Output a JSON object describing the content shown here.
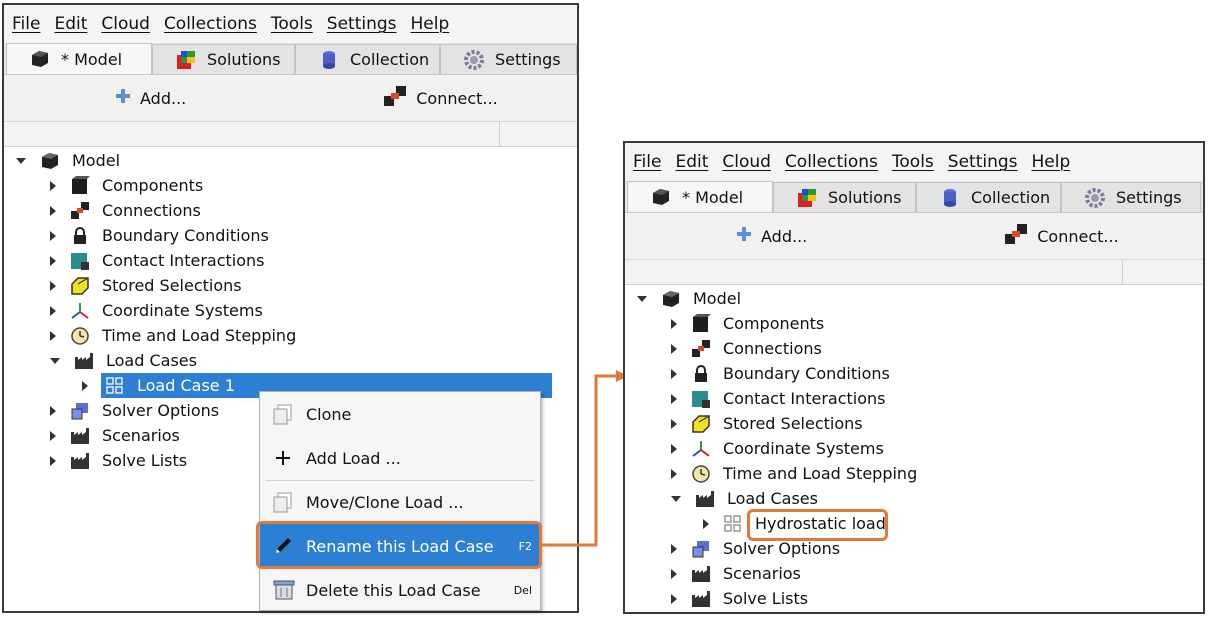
{
  "menu": [
    "File",
    "Edit",
    "Cloud",
    "Collections",
    "Tools",
    "Settings",
    "Help"
  ],
  "tabs": [
    {
      "label": "* Model",
      "icon": "model-cube-icon"
    },
    {
      "label": "Solutions",
      "icon": "solutions-icon"
    },
    {
      "label": "Collection",
      "icon": "collection-icon"
    },
    {
      "label": "Settings",
      "icon": "gear-icon"
    }
  ],
  "toolbar": {
    "add_label": "Add...",
    "connect_label": "Connect..."
  },
  "tree": {
    "root": "Model",
    "items": [
      {
        "label": "Components",
        "icon": "component-cube-icon"
      },
      {
        "label": "Connections",
        "icon": "connection-icon"
      },
      {
        "label": "Boundary Conditions",
        "icon": "lock-icon"
      },
      {
        "label": "Contact Interactions",
        "icon": "contact-icon"
      },
      {
        "label": "Stored Selections",
        "icon": "selection-icon"
      },
      {
        "label": "Coordinate Systems",
        "icon": "axes-icon"
      },
      {
        "label": "Time and Load Stepping",
        "icon": "clock-icon"
      },
      {
        "label": "Load Cases",
        "icon": "factory-icon"
      },
      {
        "label": "Solver Options",
        "icon": "solver-icon"
      },
      {
        "label": "Scenarios",
        "icon": "factory-icon"
      },
      {
        "label": "Solve Lists",
        "icon": "factory-icon"
      }
    ],
    "load_case_before": "Load Case 1",
    "load_case_after": "Hydrostatic load"
  },
  "context_menu": {
    "items": [
      {
        "label": "Clone",
        "shortcut": ""
      },
      {
        "label": "Add Load ...",
        "shortcut": ""
      },
      {
        "label": "Move/Clone Load ...",
        "shortcut": ""
      },
      {
        "label": "Rename this Load Case",
        "shortcut": "F2"
      },
      {
        "label": "Delete this Load Case",
        "shortcut": "Del"
      }
    ]
  },
  "colors": {
    "highlight": "#2d7fd3",
    "callout": "#e07a3a"
  }
}
